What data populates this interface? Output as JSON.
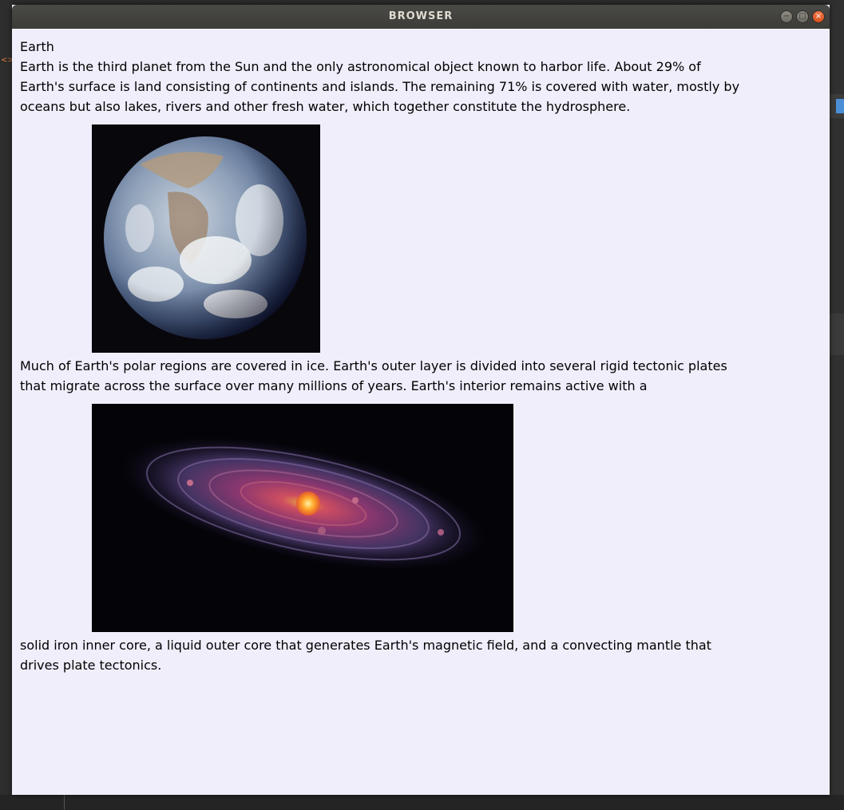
{
  "window": {
    "title": "BROWSER",
    "controls": {
      "minimize": "−",
      "maximize": "□",
      "close": "×"
    }
  },
  "page": {
    "heading": "Earth",
    "paragraphs": [
      "Earth is the third planet from the Sun and the only astronomical object known to harbor life. About 29% of Earth's surface is land consisting of continents and islands. The remaining 71% is covered with water, mostly by oceans but also lakes, rivers and other fresh water, which together constitute the hydrosphere.",
      "Much of Earth's polar regions are covered in ice. Earth's outer layer is divided into several rigid tectonic plates that migrate across the surface over many millions of years. Earth's interior remains active with a",
      "solid iron inner core, a liquid outer core that generates Earth's magnetic field, and a convecting mantle that drives plate tectonics."
    ]
  },
  "images": {
    "earth": {
      "icon": "earth-photo"
    },
    "solar_system": {
      "icon": "protoplanetary-disk-illustration"
    }
  },
  "colors": {
    "page_background": "#f0eefb",
    "titlebar": "#3c3b37",
    "close_button": "#e95420"
  }
}
